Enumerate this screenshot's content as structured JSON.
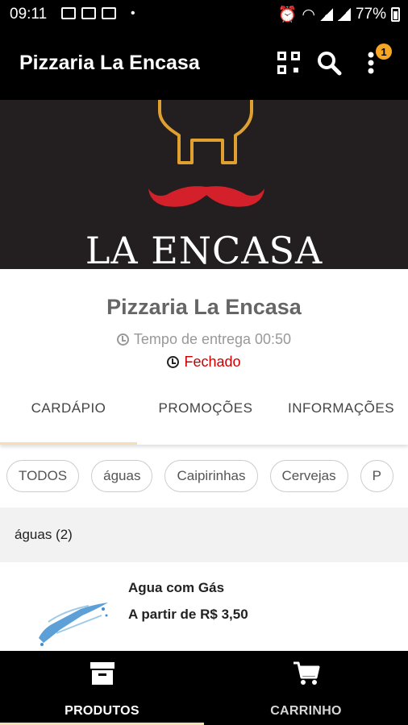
{
  "status_bar": {
    "time": "09:11",
    "battery": "77%"
  },
  "app_bar": {
    "title": "Pizzaria La Encasa",
    "notification_count": "1"
  },
  "banner": {
    "logo_text": "LA ENCASA"
  },
  "restaurant": {
    "name": "Pizzaria La Encasa",
    "delivery_time": "Tempo de entrega 00:50",
    "status": "Fechado",
    "status_color": "#cc0000"
  },
  "tabs": [
    {
      "label": "CARDÁPIO",
      "active": true
    },
    {
      "label": "PROMOÇÕES",
      "active": false
    },
    {
      "label": "INFORMAÇÕES",
      "active": false
    }
  ],
  "categories": [
    "TODOS",
    "águas",
    "Caipirinhas",
    "Cervejas",
    "P"
  ],
  "section": {
    "title": "águas (2)"
  },
  "products": [
    {
      "name": "Agua com Gás",
      "price": "A partir de R$ 3,50"
    }
  ],
  "bottom_nav": [
    {
      "label": "PRODUTOS",
      "icon": "archive-box-icon",
      "active": true
    },
    {
      "label": "CARRINHO",
      "icon": "shopping-cart-icon",
      "active": false
    }
  ],
  "colors": {
    "accent": "#f5a623",
    "header_bg": "#000000",
    "banner_bg": "#231f20",
    "tab_indicator": "#f5deb3"
  }
}
